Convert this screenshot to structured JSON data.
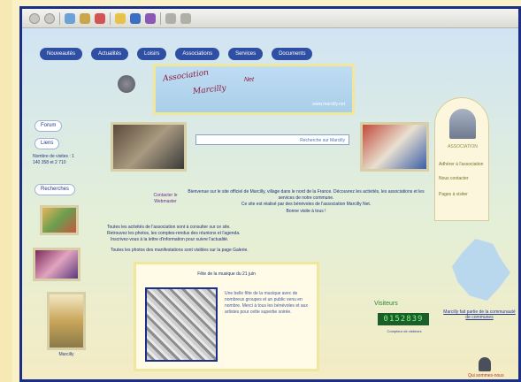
{
  "nav": {
    "items": [
      "Nouveautés",
      "Actualités",
      "Loisirs",
      "Associations",
      "Services",
      "Documents"
    ]
  },
  "banner": {
    "line1": "Association",
    "line2": "Marcilly",
    "line3": "Net",
    "sub": "www.marcilly.net"
  },
  "sidebar": {
    "btn1": "Forum",
    "btn2": "Liens",
    "info": "Nombre de visites : 1 140 358 et 2 710",
    "btn3": "Recherches",
    "caption": "Marcilly"
  },
  "search": {
    "placeholder": "Recherche sur Marcilly"
  },
  "right_panel": {
    "label": "ASSOCIATION",
    "links": [
      "Adhérer à l'association",
      "Nous contacter",
      "Pages à visiter"
    ]
  },
  "intro": {
    "left": "Contacter le Webmaster",
    "text": "Bienvenue sur le site officiel de Marcilly, village dans le nord de la France. Découvrez les activités, les associations et les services de notre commune.",
    "line2": "Ce site est réalisé par des bénévoles de l'association Marcilly Net.",
    "line3": "Bonne visite à tous !"
  },
  "para": {
    "l1": "Toutes les activités de l'association sont à consulter sur ce site.",
    "l2": "Retrouvez les photos, les comptes-rendus des réunions et l'agenda.",
    "l3": "Inscrivez-vous à la lettre d'information pour suivre l'actualité.",
    "l4": "Toutes les photos des manifestations sont visibles sur la page Galerie."
  },
  "news": {
    "title": "Fête de la musique du 21 juin",
    "body": "Une belle fête de la musique avec de nombreux groupes et un public venu en nombre. Merci à tous les bénévoles et aux artistes pour cette superbe soirée."
  },
  "counter": {
    "label": "Visiteurs",
    "value": "0152839",
    "sub": "Compteur de visiteurs"
  },
  "map": {
    "label": "Marcilly fait partie de la communauté de communes"
  },
  "footer_right": {
    "label": "Qui sommes-nous"
  }
}
